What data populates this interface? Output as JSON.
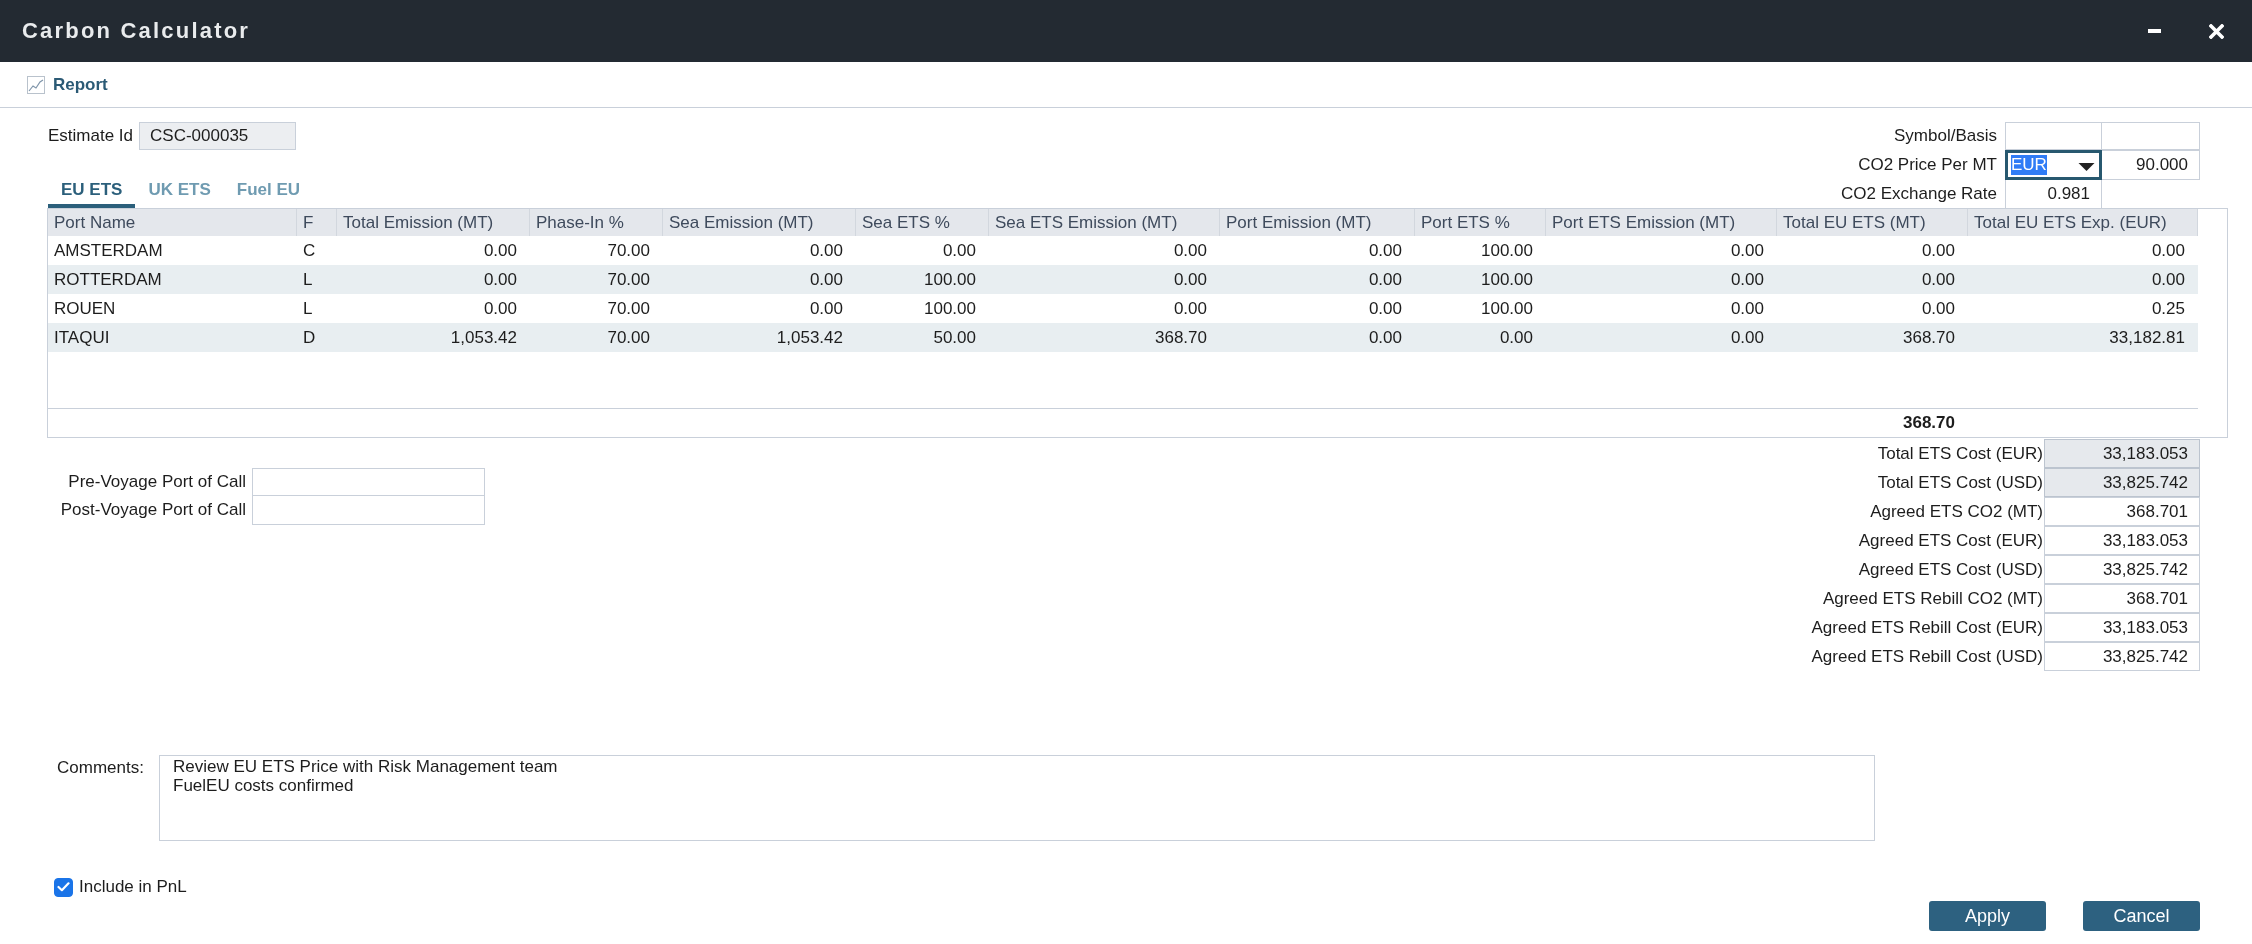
{
  "window": {
    "title": "Carbon Calculator"
  },
  "toolbar": {
    "report_label": "Report"
  },
  "estimate": {
    "label": "Estimate Id",
    "value": "CSC-000035"
  },
  "tabs": [
    {
      "label": "EU ETS",
      "selected": true
    },
    {
      "label": "UK ETS",
      "selected": false
    },
    {
      "label": "Fuel EU",
      "selected": false
    }
  ],
  "pricing": {
    "symbol_basis_label": "Symbol/Basis",
    "price_label": "CO2 Price Per MT",
    "currency": {
      "value": "EUR",
      "focused": true
    },
    "price": "90.000",
    "exchange_rate_label": "CO2 Exchange Rate",
    "exchange_rate": "0.981"
  },
  "table": {
    "columns": [
      {
        "label": "Port Name",
        "kind": "text"
      },
      {
        "label": "F",
        "kind": "text"
      },
      {
        "label": "Total Emission (MT)",
        "kind": "number"
      },
      {
        "label": "Phase-In %",
        "kind": "number"
      },
      {
        "label": "Sea Emission (MT)",
        "kind": "number"
      },
      {
        "label": "Sea ETS %",
        "kind": "number"
      },
      {
        "label": "Sea ETS Emission (MT)",
        "kind": "number"
      },
      {
        "label": "Port Emission (MT)",
        "kind": "number"
      },
      {
        "label": "Port ETS %",
        "kind": "number"
      },
      {
        "label": "Port ETS Emission (MT)",
        "kind": "number"
      },
      {
        "label": "Total EU ETS (MT)",
        "kind": "number",
        "total": "368.70"
      },
      {
        "label": "Total EU ETS Exp. (EUR)",
        "kind": "number"
      }
    ],
    "rows": [
      [
        "AMSTERDAM",
        "C",
        "0.00",
        "70.00",
        "0.00",
        "0.00",
        "0.00",
        "0.00",
        "100.00",
        "0.00",
        "0.00",
        "0.00"
      ],
      [
        "ROTTERDAM",
        "L",
        "0.00",
        "70.00",
        "0.00",
        "100.00",
        "0.00",
        "0.00",
        "100.00",
        "0.00",
        "0.00",
        "0.00"
      ],
      [
        "ROUEN",
        "L",
        "0.00",
        "70.00",
        "0.00",
        "100.00",
        "0.00",
        "0.00",
        "100.00",
        "0.00",
        "0.00",
        "0.25"
      ],
      [
        "ITAQUI",
        "D",
        "1,053.42",
        "70.00",
        "1,053.42",
        "50.00",
        "368.70",
        "0.00",
        "0.00",
        "0.00",
        "368.70",
        "33,182.81"
      ]
    ]
  },
  "port_calls": [
    {
      "label": "Pre-Voyage Port of Call"
    },
    {
      "label": "Post-Voyage Port of Call"
    }
  ],
  "totals": [
    {
      "label": "Total ETS Cost (EUR)",
      "value": "33,183.053",
      "readonly": true
    },
    {
      "label": "Total ETS Cost (USD)",
      "value": "33,825.742",
      "readonly": true
    },
    {
      "label": "Agreed ETS CO2 (MT)",
      "value": "368.701",
      "readonly": false
    },
    {
      "label": "Agreed ETS Cost (EUR)",
      "value": "33,183.053",
      "readonly": false
    },
    {
      "label": "Agreed ETS Cost (USD)",
      "value": "33,825.742",
      "readonly": false
    },
    {
      "label": "Agreed ETS Rebill CO2 (MT)",
      "value": "368.701",
      "readonly": false
    },
    {
      "label": "Agreed ETS Rebill Cost (EUR)",
      "value": "33,183.053",
      "readonly": false
    },
    {
      "label": "Agreed ETS Rebill Cost (USD)",
      "value": "33,825.742",
      "readonly": false
    }
  ],
  "comments": {
    "label": "Comments:",
    "value": "Review EU ETS Price with Risk Management team\nFuelEU costs confirmed"
  },
  "include_pnl": {
    "label": "Include in PnL",
    "checked": true
  },
  "buttons": [
    {
      "label": "Apply"
    },
    {
      "label": "Cancel"
    }
  ]
}
